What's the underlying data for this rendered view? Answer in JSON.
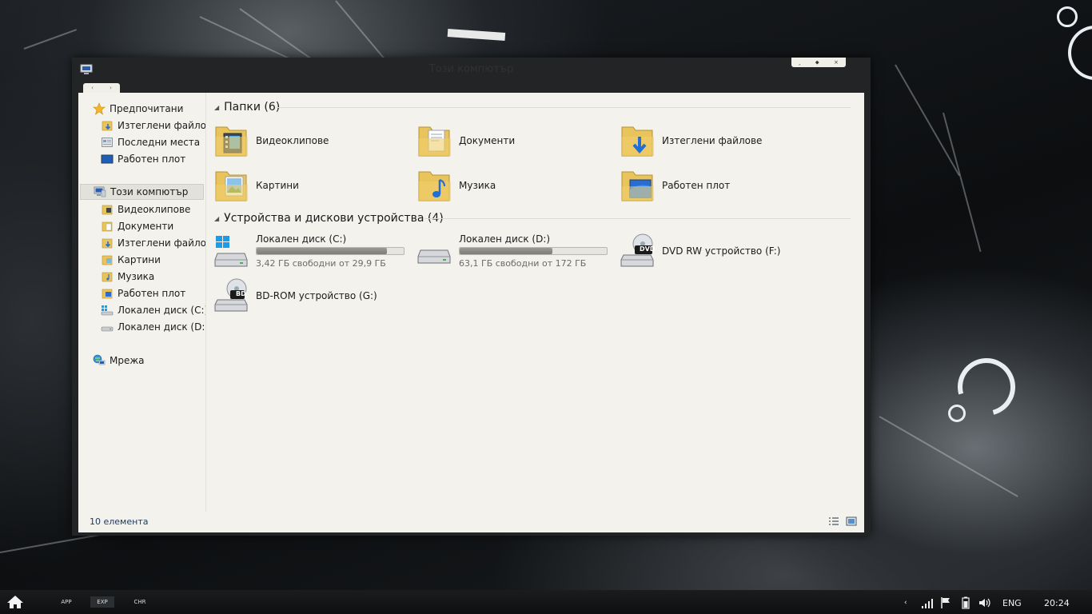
{
  "window": {
    "title": "Този компютър",
    "controls": {
      "minimize": "‸",
      "maximize": "⬥",
      "close": "×"
    },
    "nav": {
      "back": "‹",
      "forward": "›"
    }
  },
  "sidebar": {
    "favorites": {
      "label": "Предпочитани",
      "items": [
        {
          "label": "Изтеглени файлове",
          "icon": "downloads-folder-icon"
        },
        {
          "label": "Последни места",
          "icon": "recent-places-icon"
        },
        {
          "label": "Работен плот",
          "icon": "desktop-icon"
        }
      ]
    },
    "computer": {
      "label": "Този компютър",
      "items": [
        {
          "label": "Видеоклипове",
          "icon": "videos-folder-icon"
        },
        {
          "label": "Документи",
          "icon": "documents-folder-icon"
        },
        {
          "label": "Изтеглени файлове",
          "icon": "downloads-folder-icon"
        },
        {
          "label": "Картини",
          "icon": "pictures-folder-icon"
        },
        {
          "label": "Музика",
          "icon": "music-folder-icon"
        },
        {
          "label": "Работен плот",
          "icon": "desktop-folder-icon"
        },
        {
          "label": "Локален диск (C:)",
          "icon": "system-drive-icon"
        },
        {
          "label": "Локален диск (D:)",
          "icon": "drive-icon"
        }
      ]
    },
    "network": {
      "label": "Мрежа"
    }
  },
  "main": {
    "folders_group": {
      "title": "Папки (6)",
      "items": [
        {
          "label": "Видеоклипове",
          "icon": "videos-folder-icon"
        },
        {
          "label": "Документи",
          "icon": "documents-folder-icon"
        },
        {
          "label": "Изтеглени файлове",
          "icon": "downloads-folder-icon"
        },
        {
          "label": "Картини",
          "icon": "pictures-folder-icon"
        },
        {
          "label": "Музика",
          "icon": "music-folder-icon"
        },
        {
          "label": "Работен плот",
          "icon": "desktop-folder-icon"
        }
      ]
    },
    "devices_group": {
      "title": "Устройства и дискови устройства (4)",
      "drives": [
        {
          "label": "Локален диск (C:)",
          "free": "3,42 ГБ свободни от 29,9 ГБ",
          "used_fraction": 0.886
        },
        {
          "label": "Локален диск (D:)",
          "free": "63,1 ГБ свободни от 172 ГБ",
          "used_fraction": 0.633
        }
      ],
      "optical": [
        {
          "label": "DVD RW устройство (F:)",
          "badge": "DVD"
        },
        {
          "label": "BD-ROM устройство (G:)",
          "badge": "BD"
        }
      ]
    }
  },
  "status": {
    "item_count": "10 елемента"
  },
  "taskbar": {
    "apps": [
      "APP",
      "EXP",
      "CHR"
    ],
    "active_app": "EXP",
    "language": "ENG",
    "clock": "20:24",
    "tray_chevron": "‹"
  },
  "colors": {
    "accent_folder": "#e9c45c",
    "window_chrome": "#222426",
    "content_bg": "#f3f2ec"
  }
}
